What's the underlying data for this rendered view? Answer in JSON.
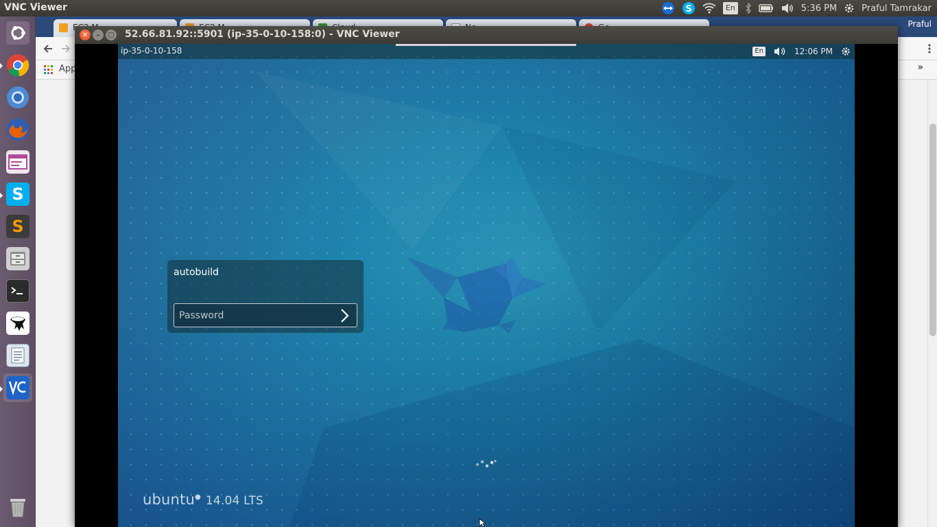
{
  "host_panel": {
    "app_title": "VNC Viewer",
    "keyboard_layout": "En",
    "time": "5:36 PM",
    "user": "Praful Tamrakar"
  },
  "launcher": {
    "items": [
      {
        "name": "dash",
        "color": "#7d6a80"
      },
      {
        "name": "chrome",
        "color": "#db4437"
      },
      {
        "name": "chromium",
        "color": "#4b8bd4"
      },
      {
        "name": "firefox",
        "color": "#e66000"
      },
      {
        "name": "app-window",
        "color": "#b04a9a"
      },
      {
        "name": "skype",
        "color": "#00aff0"
      },
      {
        "name": "sublime-text",
        "color": "#ff9800"
      },
      {
        "name": "files-archive",
        "color": "#9a9a9a"
      },
      {
        "name": "terminal",
        "color": "#2b2b2b"
      },
      {
        "name": "inkscape",
        "color": "#ffffff"
      },
      {
        "name": "text-editor",
        "color": "#dfe6ee"
      },
      {
        "name": "vnc-viewer",
        "color": "#1e63c5"
      },
      {
        "name": "trash",
        "color": "#b8b8b8"
      }
    ]
  },
  "browser": {
    "tabs": [
      "EC2 M",
      "EC2 M",
      "Cloud",
      "Ne",
      "Ge"
    ],
    "profile_name": "Praful",
    "bookmarks_label": "App",
    "overflow_label": "»"
  },
  "vnc": {
    "title": "52.66.81.92::5901 (ip-35-0-10-158:0) - VNC Viewer"
  },
  "remote": {
    "hostname": "ip-35-0-10-158",
    "keyboard_layout": "En",
    "time": "12:06 PM",
    "login": {
      "username": "autobuild",
      "password_placeholder": "Password"
    },
    "brand": {
      "name": "ubuntu",
      "version": "14.04 LTS"
    }
  }
}
